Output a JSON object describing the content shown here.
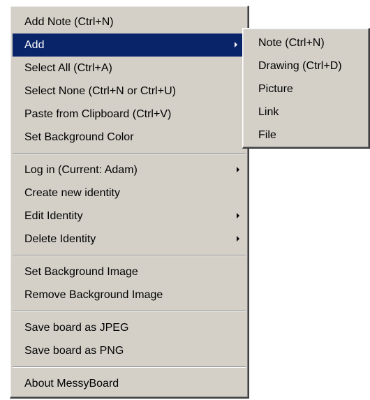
{
  "main_menu": {
    "group1": [
      {
        "label": "Add Note (Ctrl+N)"
      },
      {
        "label": "Add"
      },
      {
        "label": "Select All (Ctrl+A)"
      },
      {
        "label": "Select None (Ctrl+N or Ctrl+U)"
      },
      {
        "label": "Paste from Clipboard (Ctrl+V)"
      },
      {
        "label": "Set Background Color"
      }
    ],
    "group2": [
      {
        "label": "Log in (Current: Adam)"
      },
      {
        "label": "Create new identity"
      },
      {
        "label": "Edit Identity"
      },
      {
        "label": "Delete Identity"
      }
    ],
    "group3": [
      {
        "label": "Set Background Image"
      },
      {
        "label": "Remove Background Image"
      }
    ],
    "group4": [
      {
        "label": "Save board as JPEG"
      },
      {
        "label": "Save board as PNG"
      }
    ],
    "group5": [
      {
        "label": "About MessyBoard"
      }
    ]
  },
  "add_submenu": {
    "items": [
      {
        "label": "Note (Ctrl+N)"
      },
      {
        "label": "Drawing (Ctrl+D)"
      },
      {
        "label": "Picture"
      },
      {
        "label": "Link"
      },
      {
        "label": "File"
      }
    ]
  },
  "colors": {
    "menu_background": "#d4d0c8",
    "highlight": "#0a246a",
    "highlight_text": "#ffffff"
  },
  "icons": [
    "submenu-arrow-icon"
  ]
}
